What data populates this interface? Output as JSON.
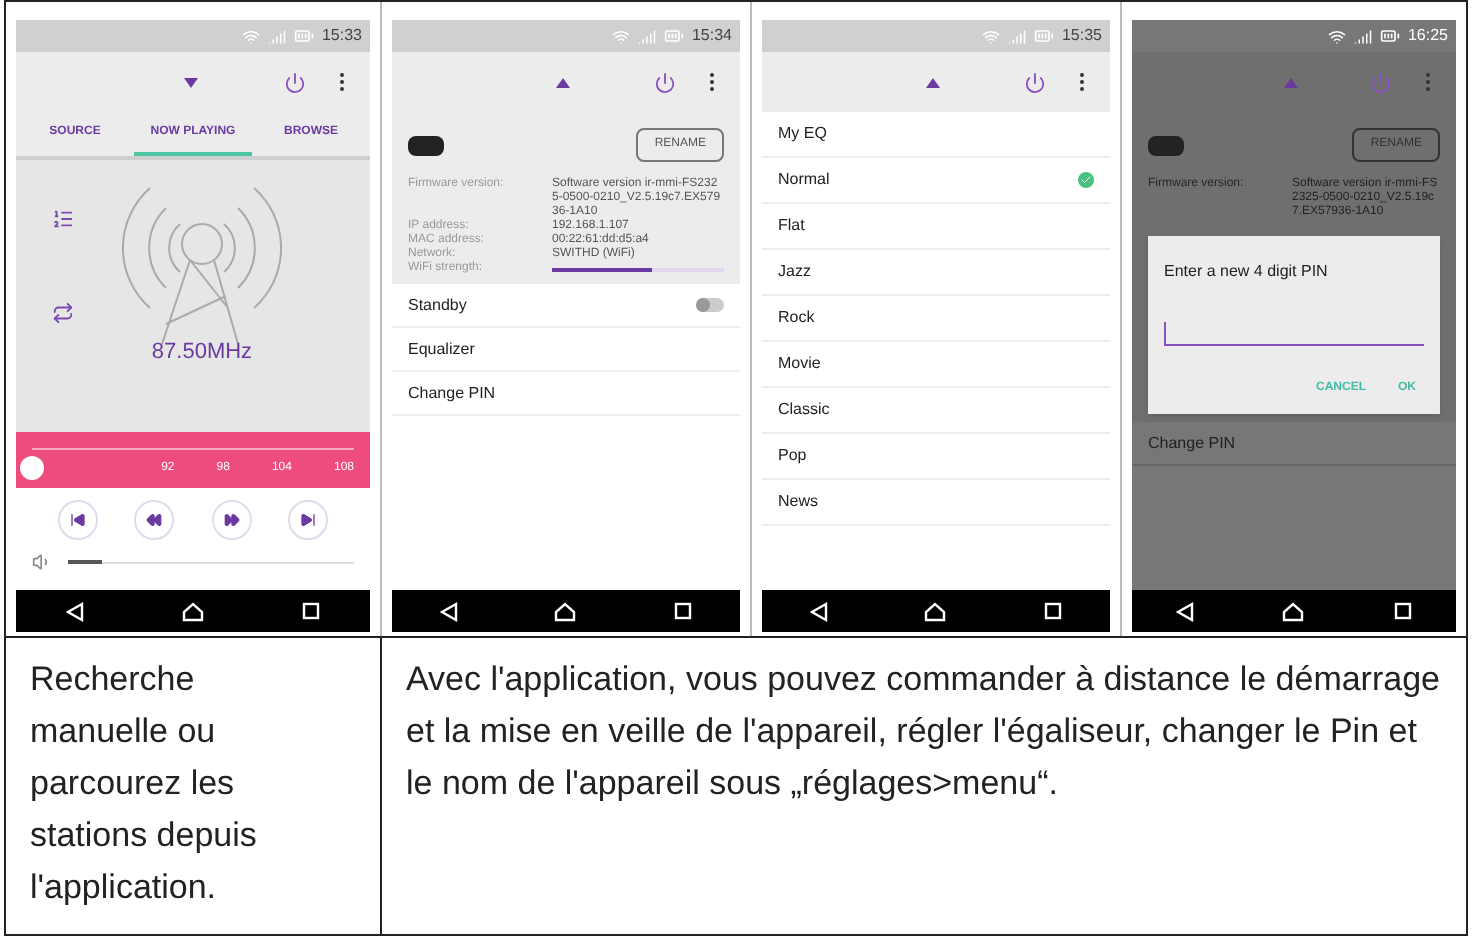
{
  "phones": [
    {
      "kind": "now_playing",
      "status_time": "15:33",
      "tabs": [
        {
          "label": "SOURCE",
          "selected": false
        },
        {
          "label": "NOW PLAYING",
          "selected": true
        },
        {
          "label": "BROWSE",
          "selected": false
        }
      ],
      "frequency": "87.50MHz",
      "scale": [
        "92",
        "98",
        "104",
        "108"
      ],
      "tuner": {
        "level": 0
      },
      "volume": {
        "level": 0.12
      }
    },
    {
      "kind": "settings",
      "status_time": "15:34",
      "rename": "RENAME",
      "info": [
        {
          "label": "Firmware version:",
          "value": "Software version ir-mmi-FS2325-0500-0210_V2.5.19c7.EX57936-1A10"
        },
        {
          "label": "IP address:",
          "value": "192.168.1.107"
        },
        {
          "label": "MAC address:",
          "value": "00:22:61:dd:d5:a4"
        },
        {
          "label": "Network:",
          "value": "SWITHD (WiFi)"
        },
        {
          "label": "WiFi strength:",
          "level": 0.58
        }
      ],
      "menu": [
        {
          "label": "Standby",
          "kind": "toggle",
          "on": false
        },
        {
          "label": "Equalizer",
          "kind": "link"
        },
        {
          "label": "Change PIN",
          "kind": "link"
        }
      ]
    },
    {
      "kind": "equalizer",
      "status_time": "15:35",
      "presets": [
        {
          "label": "My EQ",
          "selected": false
        },
        {
          "label": "Normal",
          "selected": true
        },
        {
          "label": "Flat",
          "selected": false
        },
        {
          "label": "Jazz",
          "selected": false
        },
        {
          "label": "Rock",
          "selected": false
        },
        {
          "label": "Movie",
          "selected": false
        },
        {
          "label": "Classic",
          "selected": false
        },
        {
          "label": "Pop",
          "selected": false
        },
        {
          "label": "News",
          "selected": false
        }
      ]
    },
    {
      "kind": "pin_dialog",
      "status_time": "16:25",
      "rename": "RENAME",
      "info": [
        {
          "label": "Firmware version:",
          "value": "Software version ir-mmi-FS2325-0500-0210_V2.5.19c7.EX57936-1A10"
        }
      ],
      "dialog": {
        "title": "Enter a new 4 digit PIN",
        "buttons": [
          "CANCEL",
          "OK"
        ]
      },
      "menu": [
        {
          "label": "Change PIN",
          "kind": "link"
        }
      ]
    }
  ],
  "captions": [
    "Recherche manuelle ou parcourez les stations depuis l'application.",
    "Avec l'application, vous pouvez commander à distance le démarrage et la mise en veille de l'appareil, régler l'égaliseur, changer le Pin et le nom de l'appareil sous „réglages>menu“."
  ]
}
